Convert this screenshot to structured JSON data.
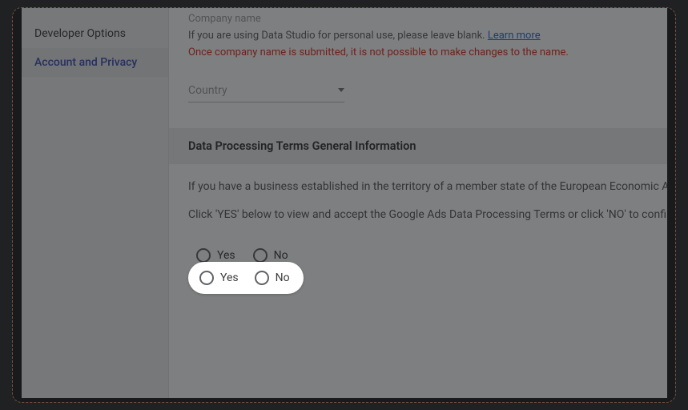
{
  "sidebar": {
    "items": [
      {
        "label": "Developer Options"
      },
      {
        "label": "Account and Privacy"
      }
    ],
    "activeIndex": 1
  },
  "company": {
    "placeholder": "Company name",
    "helper_prefix": "If you are using Data Studio for personal use, please leave blank. ",
    "learn_more": "Learn more",
    "warning": "Once company name is submitted, it is not possible to make changes to the name."
  },
  "country": {
    "placeholder": "Country"
  },
  "dpt": {
    "header": "Data Processing Terms General Information",
    "p1": "If you have a business established in the territory of a member state of the European Economic Area or Switzerland, or you are otherwise subject to the territorial scope of the General Data Protection Regulation (GDPR), then you are eligible to accept the Google Ads Data Processing Terms.",
    "p2": "Click 'YES' below to view and accept the Google Ads Data Processing Terms or click 'NO' to confirm that you do not wish to accept them.",
    "yes": "Yes",
    "no": "No"
  }
}
